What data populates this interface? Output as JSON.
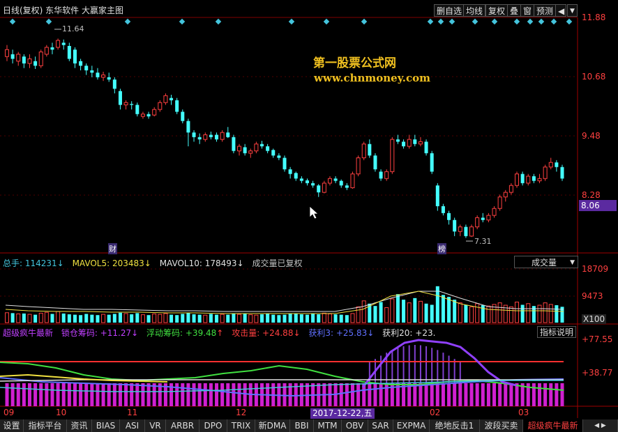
{
  "header": {
    "title": "日线(复权)  东华软件  大嬴家主图",
    "buttons": [
      "删自选",
      "均线",
      "复权",
      "叠",
      "窗",
      "预测"
    ]
  },
  "watermark": {
    "line1": "第一股票公式网",
    "line2": "www.chnmoney.com"
  },
  "price_axis": [
    "11.88",
    "10.68",
    "9.48",
    "8.28"
  ],
  "current_price": "8.06",
  "annotations": {
    "high_label": "11.64",
    "low_label": "7.31",
    "event1": "财",
    "event2": "榜"
  },
  "volume": {
    "items": [
      {
        "label": "总手: 114231",
        "arrow": "↓",
        "color": "#44c4dc"
      },
      {
        "label": "MAVOL5: 203483",
        "arrow": "↓",
        "color": "#f0e040"
      },
      {
        "label": "MAVOL10: 178493",
        "arrow": "↓",
        "color": "#e0e0e0"
      },
      {
        "label": "成交量已复权",
        "arrow": "",
        "color": "#c0c0c0"
      }
    ],
    "selector": "成交量",
    "axis": [
      "18709",
      "9473",
      "X100"
    ]
  },
  "indicator": {
    "items": [
      {
        "label": "超级疯牛最新",
        "color": "#c040ff"
      },
      {
        "label": "锁仓筹码: +11.27",
        "arrow": "↓",
        "color": "#c040ff"
      },
      {
        "label": "浮动筹码: +39.48",
        "arrow": "↑",
        "color": "#40e040"
      },
      {
        "label": "攻击量: +24.88",
        "arrow": "↓",
        "color": "#ff4040"
      },
      {
        "label": "获利3: +25.83",
        "arrow": "↓",
        "color": "#6070ff"
      },
      {
        "label": "获利20: +23.",
        "arrow": "",
        "color": "#e0e0e0"
      }
    ],
    "help_button": "指标说明",
    "axis": [
      "+77.55",
      "+38.77"
    ]
  },
  "x_axis": [
    "09",
    "10",
    "11",
    "12",
    "02",
    "03"
  ],
  "cursor_date": "2017-12-22,五",
  "tabs": [
    "设置",
    "指标平台",
    "资讯",
    "BIAS",
    "ASI",
    "VR",
    "ARBR",
    "DPO",
    "TRIX",
    "新DMA",
    "BBI",
    "MTM",
    "OBV",
    "SAR",
    "EXPMA",
    "绝地反击1",
    "波段买卖",
    "超级疯牛最新"
  ],
  "active_tab": "超级疯牛最新",
  "colors": {
    "up": "#ff4040",
    "down": "#44ffff",
    "accent": "#5b2aa0"
  },
  "chart_data": {
    "type": "candlestick",
    "y_range": [
      7.0,
      12.1
    ],
    "candles": [
      [
        11.25,
        11.4,
        11.5,
        11.15
      ],
      [
        11.3,
        11.2,
        11.4,
        11.1
      ],
      [
        11.15,
        11.3,
        11.35,
        11.05
      ],
      [
        11.25,
        11.1,
        11.3,
        11.0
      ],
      [
        11.1,
        11.2,
        11.3,
        11.0
      ],
      [
        11.15,
        11.05,
        11.25,
        10.98
      ],
      [
        11.05,
        11.35,
        11.4,
        11.0
      ],
      [
        11.3,
        11.45,
        11.5,
        11.25
      ],
      [
        11.45,
        11.4,
        11.55,
        11.3
      ],
      [
        11.45,
        11.6,
        11.64,
        11.4
      ],
      [
        11.55,
        11.5,
        11.62,
        11.4
      ],
      [
        11.48,
        11.2,
        11.55,
        11.15
      ],
      [
        11.4,
        11.1,
        11.45,
        11.0
      ],
      [
        11.15,
        11.05,
        11.2,
        10.95
      ],
      [
        11.05,
        10.95,
        11.1,
        10.85
      ],
      [
        10.95,
        10.9,
        11.05,
        10.8
      ],
      [
        10.9,
        10.8,
        11.0,
        10.75
      ],
      [
        10.8,
        10.85,
        10.92,
        10.72
      ],
      [
        10.8,
        10.75,
        10.9,
        10.7
      ],
      [
        10.75,
        10.55,
        10.8,
        10.45
      ],
      [
        10.5,
        10.2,
        10.55,
        10.1
      ],
      [
        10.2,
        10.25,
        10.3,
        10.1
      ],
      [
        10.22,
        10.2,
        10.28,
        10.1
      ],
      [
        10.2,
        10.0,
        10.25,
        9.95
      ],
      [
        9.95,
        10.0,
        10.05,
        9.9
      ],
      [
        10.0,
        9.95,
        10.05,
        9.9
      ],
      [
        9.98,
        10.1,
        10.15,
        9.95
      ],
      [
        10.1,
        10.25,
        10.3,
        10.05
      ],
      [
        10.25,
        10.4,
        10.45,
        10.2
      ],
      [
        10.35,
        10.3,
        10.42,
        10.2
      ],
      [
        10.3,
        10.05,
        10.35,
        10.0
      ],
      [
        10.05,
        9.85,
        10.1,
        9.8
      ],
      [
        9.85,
        9.6,
        9.9,
        9.3
      ],
      [
        9.6,
        9.5,
        9.65,
        9.4
      ],
      [
        9.5,
        9.45,
        9.58,
        9.35
      ],
      [
        9.45,
        9.55,
        9.6,
        9.4
      ],
      [
        9.55,
        9.5,
        9.62,
        9.45
      ],
      [
        9.55,
        9.45,
        9.6,
        9.4
      ],
      [
        9.45,
        9.6,
        9.65,
        9.4
      ],
      [
        9.6,
        9.5,
        9.72,
        9.48
      ],
      [
        9.5,
        9.2,
        9.55,
        9.15
      ],
      [
        9.2,
        9.3,
        9.35,
        9.1
      ],
      [
        9.28,
        9.15,
        9.35,
        9.1
      ],
      [
        9.15,
        9.2,
        9.25,
        9.05
      ],
      [
        9.2,
        9.35,
        9.4,
        9.15
      ],
      [
        9.35,
        9.3,
        9.42,
        9.25
      ],
      [
        9.3,
        9.2,
        9.35,
        9.15
      ],
      [
        9.22,
        9.1,
        9.25,
        9.05
      ],
      [
        9.1,
        9.05,
        9.15,
        9.0
      ],
      [
        9.05,
        8.8,
        9.1,
        8.75
      ],
      [
        8.8,
        8.7,
        8.85,
        8.6
      ],
      [
        8.72,
        8.6,
        8.75,
        8.55
      ],
      [
        8.6,
        8.55,
        8.65,
        8.5
      ],
      [
        8.56,
        8.5,
        8.6,
        8.45
      ],
      [
        8.5,
        8.45,
        8.55,
        8.4
      ],
      [
        8.45,
        8.3,
        8.48,
        8.2
      ],
      [
        8.3,
        8.5,
        8.55,
        8.28
      ],
      [
        8.5,
        8.6,
        8.65,
        8.45
      ],
      [
        8.6,
        8.55,
        8.65,
        8.5
      ],
      [
        8.55,
        8.45,
        8.58,
        8.4
      ],
      [
        8.45,
        8.4,
        8.5,
        8.35
      ],
      [
        8.4,
        8.7,
        8.75,
        8.38
      ],
      [
        8.7,
        9.05,
        9.1,
        8.65
      ],
      [
        9.05,
        9.35,
        9.4,
        9.0
      ],
      [
        9.35,
        9.1,
        9.45,
        9.05
      ],
      [
        9.1,
        8.8,
        9.15,
        8.75
      ],
      [
        8.75,
        8.6,
        8.8,
        8.55
      ],
      [
        8.6,
        8.75,
        8.8,
        8.55
      ],
      [
        8.75,
        9.45,
        9.5,
        8.7
      ],
      [
        9.45,
        9.4,
        9.55,
        9.35
      ],
      [
        9.4,
        9.3,
        9.45,
        9.25
      ],
      [
        9.3,
        9.45,
        9.55,
        9.25
      ],
      [
        9.45,
        9.35,
        9.55,
        9.3
      ],
      [
        9.35,
        9.4,
        9.5,
        9.3
      ],
      [
        9.4,
        9.15,
        9.45,
        9.1
      ],
      [
        9.15,
        8.75,
        9.2,
        8.7
      ],
      [
        8.45,
        8.0,
        8.5,
        7.9
      ],
      [
        8.0,
        7.85,
        8.05,
        7.8
      ],
      [
        7.85,
        7.7,
        7.9,
        7.6
      ],
      [
        7.7,
        7.45,
        7.75,
        7.35
      ],
      [
        7.45,
        7.55,
        7.6,
        7.35
      ],
      [
        7.55,
        7.35,
        7.6,
        7.31
      ],
      [
        7.35,
        7.55,
        7.6,
        7.33
      ],
      [
        7.55,
        7.75,
        7.8,
        7.5
      ],
      [
        7.75,
        7.7,
        7.85,
        7.65
      ],
      [
        7.7,
        7.8,
        7.85,
        7.65
      ],
      [
        7.8,
        7.95,
        8.0,
        7.75
      ],
      [
        7.95,
        8.2,
        8.25,
        7.9
      ],
      [
        8.2,
        8.3,
        8.35,
        8.1
      ],
      [
        8.3,
        8.45,
        8.5,
        8.25
      ],
      [
        8.45,
        8.7,
        8.75,
        8.4
      ],
      [
        8.7,
        8.5,
        8.75,
        8.45
      ],
      [
        8.5,
        8.65,
        8.7,
        8.45
      ],
      [
        8.65,
        8.55,
        8.7,
        8.5
      ],
      [
        8.55,
        8.6,
        8.7,
        8.5
      ],
      [
        8.6,
        8.85,
        8.9,
        8.55
      ],
      [
        8.85,
        8.95,
        9.05,
        8.8
      ],
      [
        8.95,
        8.85,
        9.0,
        8.75
      ],
      [
        8.85,
        8.6,
        8.9,
        8.55
      ]
    ],
    "volume": [
      25,
      24,
      22,
      23,
      21,
      20,
      24,
      26,
      22,
      28,
      23,
      21,
      20,
      19,
      22,
      20,
      19,
      21,
      20,
      22,
      25,
      23,
      21,
      24,
      20,
      19,
      22,
      21,
      23,
      20,
      19,
      22,
      24,
      21,
      20,
      19,
      22,
      20,
      21,
      20,
      23,
      21,
      22,
      20,
      19,
      21,
      22,
      20,
      19,
      20,
      23,
      22,
      21,
      20,
      22,
      21,
      24,
      22,
      21,
      20,
      19,
      23,
      40,
      55,
      48,
      42,
      52,
      38,
      60,
      72,
      58,
      50,
      62,
      54,
      48,
      45,
      92,
      70,
      65,
      58,
      50,
      45,
      40,
      48,
      44,
      42,
      46,
      50,
      44,
      40,
      52,
      45,
      48,
      42,
      44,
      50,
      46,
      44,
      40
    ],
    "volume_range": [
      0,
      190
    ]
  }
}
